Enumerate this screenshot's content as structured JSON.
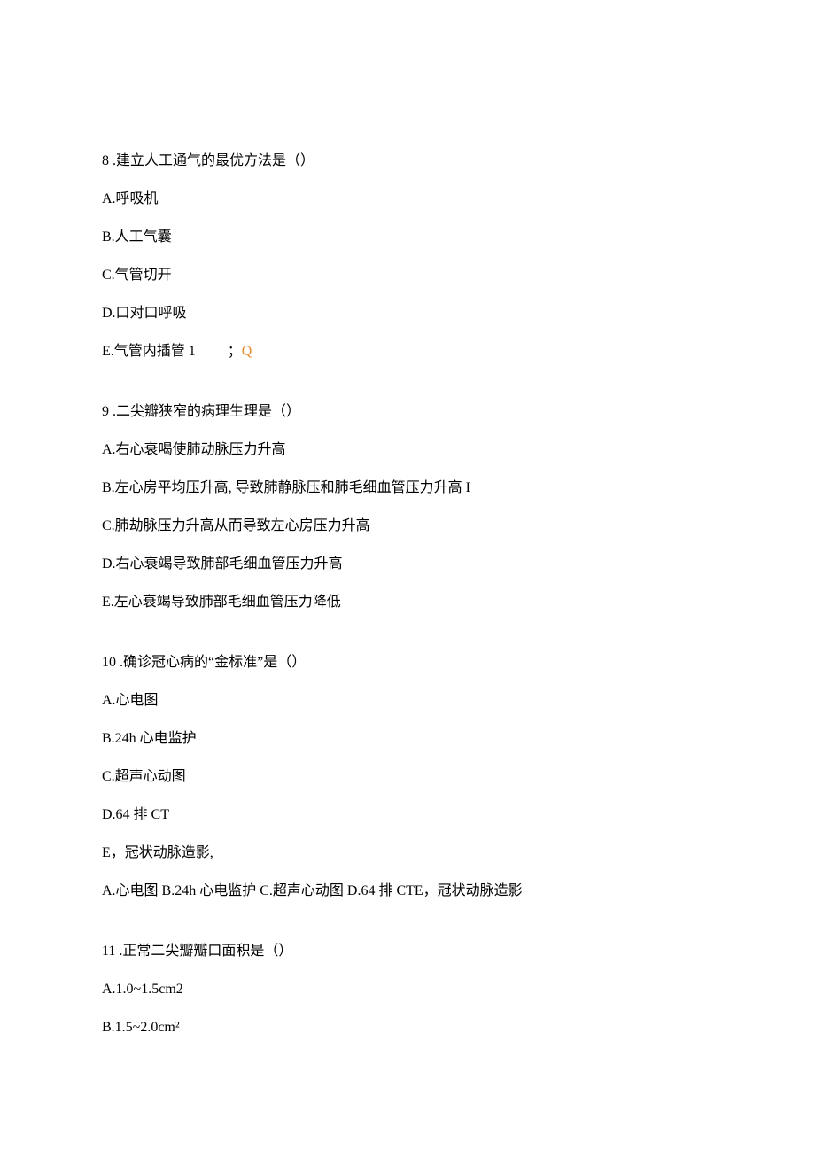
{
  "q8": {
    "stem": "8   .建立人工通气的最优方法是（）",
    "a": "A.呼吸机",
    "b": "B.人工气囊",
    "c": "C.气管切开",
    "d": "D.口对口呼吸",
    "e_prefix": "E.气管内插管 1",
    "e_semi": "；",
    "e_q": "Q"
  },
  "q9": {
    "stem": "9   .二尖瓣狭窄的病理生理是（）",
    "a": "A.右心衰喝使肺动脉压力升高",
    "b": "B.左心房平均压升高, 导致肺静脉压和肺毛细血管压力升高 I",
    "c": "C.肺劫脉压力升高从而导致左心房压力升高",
    "d": "D.右心衰竭导致肺部毛细血管压力升高",
    "e": "E.左心衰竭导致肺部毛细血管压力降低"
  },
  "q10": {
    "stem": "10   .确诊冠心病的“金标准”是（）",
    "a": "A.心电图",
    "b": "B.24h 心电监护",
    "c": "C.超声心动图",
    "d": "D.64 排 CT",
    "e": "E，冠状动脉造影,",
    "extra": "A.心电图 B.24h 心电监护 C.超声心动图 D.64 排 CTE，冠状动脉造影"
  },
  "q11": {
    "stem": "11   .正常二尖瓣瓣口面积是（）",
    "a": "A.1.0~1.5cm2",
    "b": "B.1.5~2.0cm²"
  }
}
